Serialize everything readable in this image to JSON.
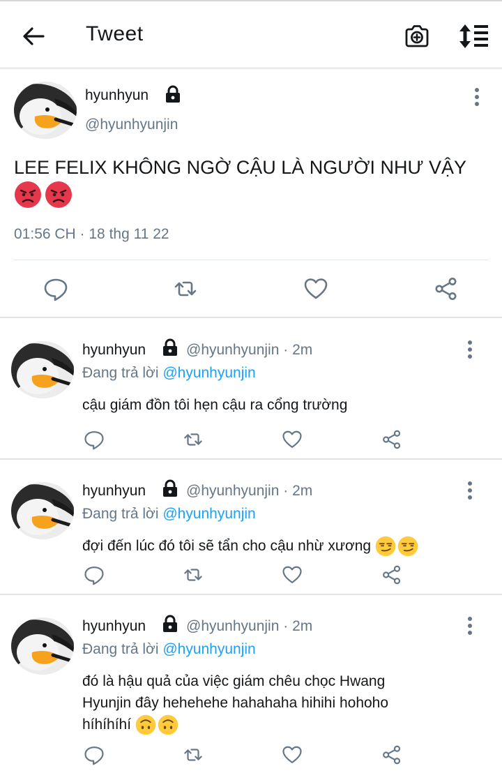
{
  "topbar": {
    "title": "Tweet"
  },
  "main_tweet": {
    "name": "hyunhyun",
    "handle": "@hyunhyunjin",
    "text": "LEE FELIX KHÔNG NGỜ CẬU LÀ NGƯỜI NHƯ VẬY",
    "emojis": [
      "angry-face-emoji",
      "angry-face-emoji"
    ],
    "timestamp": "01:56 CH · 18 thg 11 22"
  },
  "replies": [
    {
      "name": "hyunhyun",
      "meta": "@hyunhyunjin · 2m",
      "replying_prefix": "Đang trả lời",
      "replying_to": "@hyunhyunjin",
      "text": "cậu giám đồn tôi hẹn cậu ra cổng trường",
      "emojis": []
    },
    {
      "name": "hyunhyun",
      "meta": "@hyunhyunjin · 2m",
      "replying_prefix": "Đang trả lời",
      "replying_to": "@hyunhyunjin",
      "text": "đợi đến lúc đó tôi sẽ tẩn cho cậu nhừ xương",
      "emojis": [
        "smirking-face-emoji",
        "smirking-face-emoji"
      ]
    },
    {
      "name": "hyunhyun",
      "meta": "@hyunhyunjin · 2m",
      "replying_prefix": "Đang trả lời",
      "replying_to": "@hyunhyunjin",
      "text": "đó là hậu quả của việc giám chêu chọc Hwang Hyunjin đây hehehehe hahahaha hihihi hohoho híhíhíhí",
      "emojis": [
        "upside-down-face-emoji",
        "upside-down-face-emoji"
      ]
    }
  ],
  "colors": {
    "text": "#14171a",
    "secondary": "#657786",
    "link": "#1da1f2",
    "icon": "#657786"
  }
}
